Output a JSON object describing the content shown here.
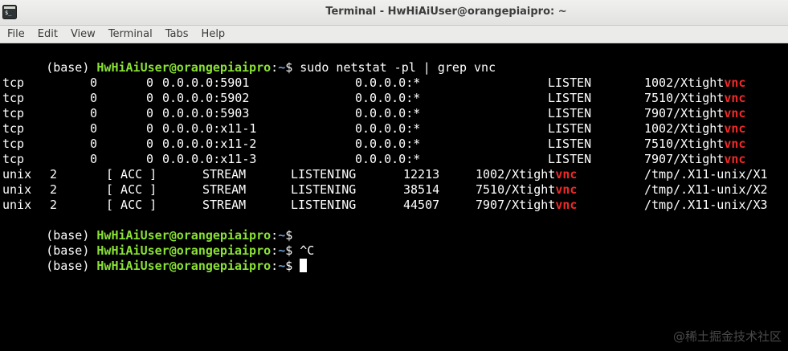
{
  "window": {
    "title": "Terminal - HwHiAiUser@orangepiaipro: ~"
  },
  "menu": [
    "File",
    "Edit",
    "View",
    "Terminal",
    "Tabs",
    "Help"
  ],
  "prompt": {
    "prefix": "(base) ",
    "user_host": "HwHiAiUser@orangepiaipro",
    "colon": ":",
    "path": "~",
    "dollar": "$ "
  },
  "command": "sudo netstat -pl | grep vnc",
  "tcp_rows": [
    {
      "proto": "tcp",
      "recvq": "0",
      "sendq": "0",
      "local": "0.0.0.0:5901",
      "foreign": "0.0.0.0:*",
      "state": "LISTEN",
      "prog": "1002/Xtight",
      "match": "vnc"
    },
    {
      "proto": "tcp",
      "recvq": "0",
      "sendq": "0",
      "local": "0.0.0.0:5902",
      "foreign": "0.0.0.0:*",
      "state": "LISTEN",
      "prog": "7510/Xtight",
      "match": "vnc"
    },
    {
      "proto": "tcp",
      "recvq": "0",
      "sendq": "0",
      "local": "0.0.0.0:5903",
      "foreign": "0.0.0.0:*",
      "state": "LISTEN",
      "prog": "7907/Xtight",
      "match": "vnc"
    },
    {
      "proto": "tcp",
      "recvq": "0",
      "sendq": "0",
      "local": "0.0.0.0:x11-1",
      "foreign": "0.0.0.0:*",
      "state": "LISTEN",
      "prog": "1002/Xtight",
      "match": "vnc"
    },
    {
      "proto": "tcp",
      "recvq": "0",
      "sendq": "0",
      "local": "0.0.0.0:x11-2",
      "foreign": "0.0.0.0:*",
      "state": "LISTEN",
      "prog": "7510/Xtight",
      "match": "vnc"
    },
    {
      "proto": "tcp",
      "recvq": "0",
      "sendq": "0",
      "local": "0.0.0.0:x11-3",
      "foreign": "0.0.0.0:*",
      "state": "LISTEN",
      "prog": "7907/Xtight",
      "match": "vnc"
    }
  ],
  "unix_rows": [
    {
      "proto": "unix",
      "refcnt": "2",
      "flags": "[ ACC ]",
      "type": "STREAM",
      "state": "LISTENING",
      "inode": "12213",
      "prog": "1002/Xtight",
      "match": "vnc",
      "path": "/tmp/.X11-unix/X1"
    },
    {
      "proto": "unix",
      "refcnt": "2",
      "flags": "[ ACC ]",
      "type": "STREAM",
      "state": "LISTENING",
      "inode": "38514",
      "prog": "7510/Xtight",
      "match": "vnc",
      "path": "/tmp/.X11-unix/X2"
    },
    {
      "proto": "unix",
      "refcnt": "2",
      "flags": "[ ACC ]",
      "type": "STREAM",
      "state": "LISTENING",
      "inode": "44507",
      "prog": "7907/Xtight",
      "match": "vnc",
      "path": "/tmp/.X11-unix/X3"
    }
  ],
  "after_prompts": [
    {
      "input": ""
    },
    {
      "input": "^C"
    },
    {
      "input": ""
    }
  ],
  "watermark": "@稀土掘金技术社区",
  "colors": {
    "user_host": "#8ae234",
    "path": "#729fcf",
    "match": "#ef2929",
    "background": "#000000"
  }
}
